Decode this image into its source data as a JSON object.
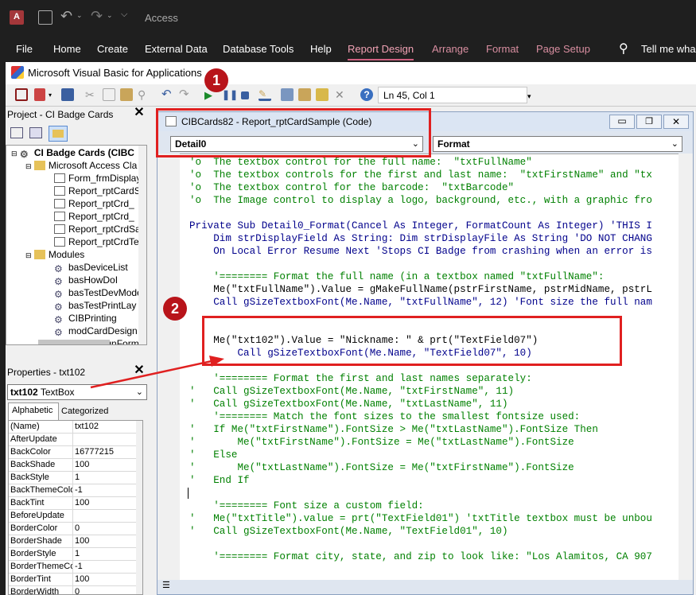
{
  "app_title": "Access",
  "ribbon": {
    "tabs": [
      "File",
      "Home",
      "Create",
      "External Data",
      "Database Tools",
      "Help",
      "Report Design",
      "Arrange",
      "Format",
      "Page Setup"
    ],
    "active_tab": "Report Design",
    "tell_me": "Tell me wha"
  },
  "vba": {
    "title": "Microsoft Visual Basic for Applications",
    "position": "Ln 45, Col 1"
  },
  "project": {
    "header": "Project - CI Badge Cards",
    "root": "CI Badge Cards (CIBC",
    "folder_objects": "Microsoft Access Cla",
    "objects": [
      "Form_frmDisplay",
      "Report_rptCardS",
      "Report_rptCrd_",
      "Report_rptCrd_",
      "Report_rptCrdSa",
      "Report_rptCrdTe"
    ],
    "folder_modules": "Modules",
    "modules": [
      "basDeviceList",
      "basHowDoI",
      "basTestDevMode",
      "basTestPrintLay",
      "CIBPrinting",
      "modCardDesign",
      "modDesignForm"
    ]
  },
  "properties": {
    "header": "Properties - txt102",
    "object_name": "txt102",
    "object_type": "TextBox",
    "tabs": [
      "Alphabetic",
      "Categorized"
    ],
    "rows": [
      [
        "(Name)",
        "txt102"
      ],
      [
        "AfterUpdate",
        ""
      ],
      [
        "BackColor",
        "16777215"
      ],
      [
        "BackShade",
        "100"
      ],
      [
        "BackStyle",
        "1"
      ],
      [
        "BackThemeColo",
        "-1"
      ],
      [
        "BackTint",
        "100"
      ],
      [
        "BeforeUpdate",
        ""
      ],
      [
        "BorderColor",
        "0"
      ],
      [
        "BorderShade",
        "100"
      ],
      [
        "BorderStyle",
        "1"
      ],
      [
        "BorderThemeCo",
        "-1"
      ],
      [
        "BorderTint",
        "100"
      ],
      [
        "BorderWidth",
        "0"
      ]
    ]
  },
  "code_window": {
    "title": "CIBCards82 - Report_rptCardSample (Code)",
    "object_dropdown": "Detail0",
    "proc_dropdown": "Format",
    "lines": [
      {
        "t": "'o  The textbox control for the full name:  \"txtFullName\"",
        "c": "g"
      },
      {
        "t": "'o  The textbox controls for the first and last name:  \"txtFirstName\" and \"tx",
        "c": "g"
      },
      {
        "t": "'o  The textbox control for the barcode:  \"txtBarcode\"",
        "c": "g"
      },
      {
        "t": "'o  The Image control to display a logo, background, etc., with a graphic fro",
        "c": "g"
      },
      {
        "t": "",
        "c": "k"
      },
      {
        "t": "Private Sub Detail0_Format(Cancel As Integer, FormatCount As Integer) 'THIS I",
        "c": "b"
      },
      {
        "t": "    Dim strDisplayField As String: Dim strDisplayFile As String 'DO NOT CHANG",
        "c": "b"
      },
      {
        "t": "    On Local Error Resume Next 'Stops CI Badge from crashing when an error is",
        "c": "b"
      },
      {
        "t": "",
        "c": "k"
      },
      {
        "t": "    '======== Format the full name (in a textbox named \"txtFullName\":",
        "c": "g"
      },
      {
        "t": "    Me(\"txtFullName\").Value = gMakeFullName(pstrFirstName, pstrMidName, pstrL",
        "c": "k"
      },
      {
        "t": "    Call gSizeTextboxFont(Me.Name, \"txtFullName\", 12) 'Font size the full nam",
        "c": "b"
      },
      {
        "t": "",
        "c": "k"
      },
      {
        "t": "",
        "c": "k"
      },
      {
        "t": "    Me(\"txt102\").Value = \"Nickname: \" & prt(\"TextField07\")",
        "c": "k"
      },
      {
        "t": "        Call gSizeTextboxFont(Me.Name, \"TextField07\", 10)",
        "c": "b"
      },
      {
        "t": "",
        "c": "k"
      },
      {
        "t": "    '======== Format the first and last names separately:",
        "c": "g"
      },
      {
        "t": "'   Call gSizeTextboxFont(Me.Name, \"txtFirstName\", 11)",
        "c": "g"
      },
      {
        "t": "'   Call gSizeTextboxFont(Me.Name, \"txtLastName\", 11)",
        "c": "g"
      },
      {
        "t": "    '======== Match the font sizes to the smallest fontsize used:",
        "c": "g"
      },
      {
        "t": "'   If Me(\"txtFirstName\").FontSize > Me(\"txtLastName\").FontSize Then",
        "c": "g"
      },
      {
        "t": "'       Me(\"txtFirstName\").FontSize = Me(\"txtLastName\").FontSize",
        "c": "g"
      },
      {
        "t": "'   Else",
        "c": "g"
      },
      {
        "t": "'       Me(\"txtLastName\").FontSize = Me(\"txtFirstName\").FontSize",
        "c": "g"
      },
      {
        "t": "'   End If",
        "c": "g"
      },
      {
        "t": "",
        "c": "k"
      },
      {
        "t": "    '======== Font size a custom field:",
        "c": "g"
      },
      {
        "t": "'   Me(\"txtTitle\").value = prt(\"TextField01\") 'txtTitle textbox must be unbou",
        "c": "g"
      },
      {
        "t": "'   Call gSizeTextboxFont(Me.Name, \"TextField01\", 10)",
        "c": "g"
      },
      {
        "t": "",
        "c": "k"
      },
      {
        "t": "    '======== Format city, state, and zip to look like: \"Los Alamitos, CA 907",
        "c": "g"
      }
    ]
  },
  "badges": [
    "1",
    "2"
  ]
}
